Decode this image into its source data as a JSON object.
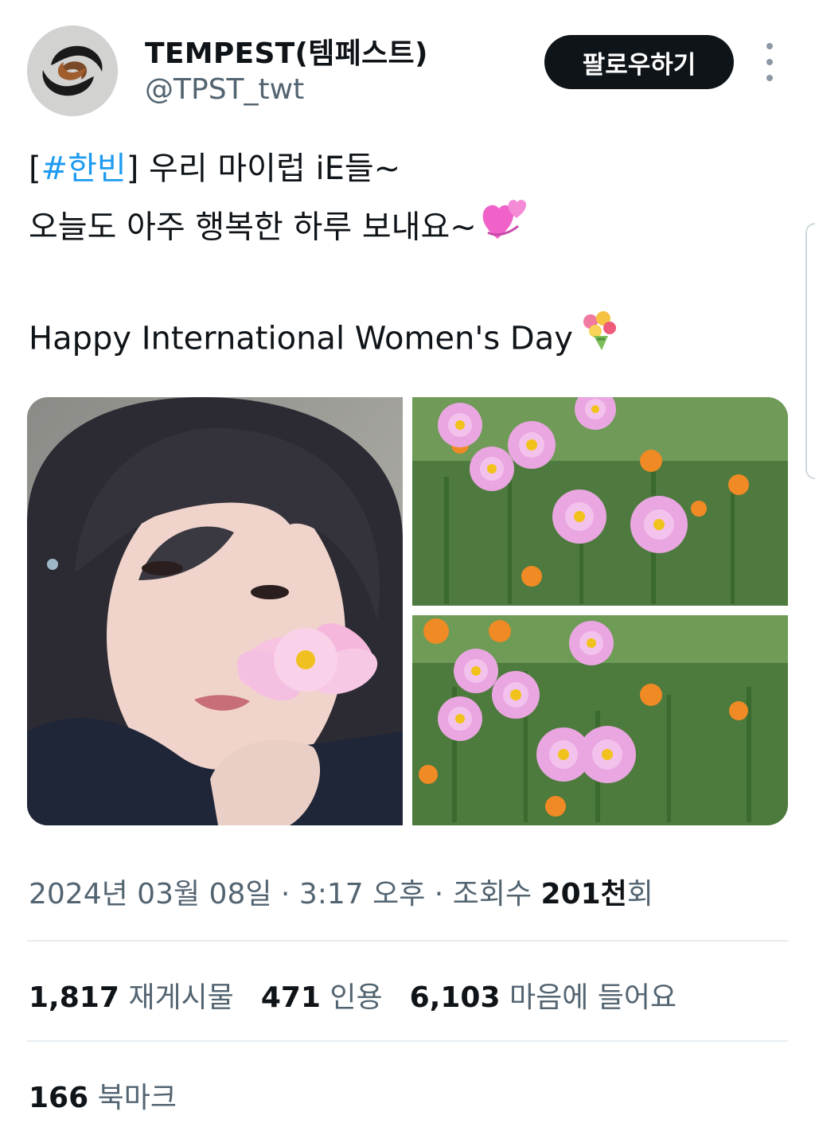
{
  "author": {
    "name": "TEMPEST(템페스트)",
    "handle": "@TPST_twt",
    "avatar_icon": "tempest-swirl-logo"
  },
  "follow_button": {
    "label": "팔로우하기"
  },
  "more_icon": "vertical-ellipsis-icon",
  "tweet": {
    "hashtag_open": "[",
    "hashtag": "#한빈",
    "hashtag_close": "]",
    "line1_rest": " 우리 마이럽 iE들~",
    "line2": "오늘도 아주 행복한 하루 보내요~",
    "line2_emoji": "two-hearts-emoji",
    "line3": "Happy International Women's Day",
    "line3_emoji": "bouquet-emoji"
  },
  "media": [
    {
      "name": "portrait-photo",
      "description_icon": "photo"
    },
    {
      "name": "cosmos-flowers-photo-1",
      "description_icon": "photo"
    },
    {
      "name": "cosmos-flowers-photo-2",
      "description_icon": "photo"
    }
  ],
  "meta": {
    "date": "2024년 03월 08일",
    "sep1": " · ",
    "time": "3:17 오후",
    "sep2": " · ",
    "views_label": "조회수 ",
    "views_value": "201천",
    "views_suffix": "회"
  },
  "stats": {
    "reposts_count": "1,817",
    "reposts_label": " 재게시물",
    "quotes_count": "471",
    "quotes_label": " 인용",
    "likes_count": "6,103",
    "likes_label": " 마음에 들어요"
  },
  "bookmarks": {
    "count": "166",
    "label": " 북마크"
  },
  "colors": {
    "hashtag": "#1d9bf0",
    "secondary_text": "#536471",
    "primary_text": "#0f1419",
    "button_bg": "#0f1419",
    "divider": "#e6ecf0"
  }
}
